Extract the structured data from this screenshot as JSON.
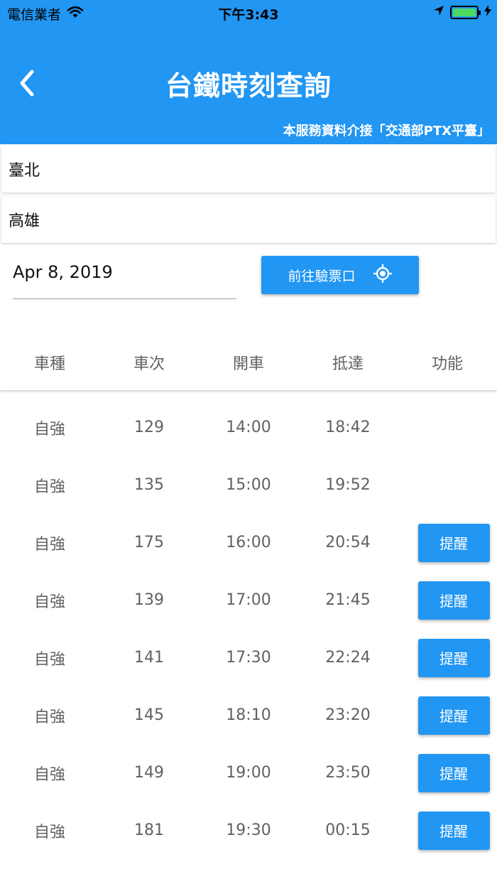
{
  "status_bar": {
    "carrier": "電信業者",
    "time": "下午3:43"
  },
  "header": {
    "title": "台鐵時刻查詢",
    "data_source": "本服務資料介接「交通部PTX平臺」"
  },
  "stations": {
    "origin": "臺北",
    "destination": "高雄"
  },
  "date": {
    "value": "Apr 8, 2019"
  },
  "gate_button": {
    "label": "前往驗票口"
  },
  "table": {
    "headers": [
      "車種",
      "車次",
      "開車",
      "抵達",
      "功能"
    ],
    "remind_label": "提醒",
    "rows": [
      {
        "type": "自強",
        "train": "129",
        "depart": "14:00",
        "arrive": "18:42",
        "remind": false
      },
      {
        "type": "自強",
        "train": "135",
        "depart": "15:00",
        "arrive": "19:52",
        "remind": false
      },
      {
        "type": "自強",
        "train": "175",
        "depart": "16:00",
        "arrive": "20:54",
        "remind": true
      },
      {
        "type": "自強",
        "train": "139",
        "depart": "17:00",
        "arrive": "21:45",
        "remind": true
      },
      {
        "type": "自強",
        "train": "141",
        "depart": "17:30",
        "arrive": "22:24",
        "remind": true
      },
      {
        "type": "自強",
        "train": "145",
        "depart": "18:10",
        "arrive": "23:20",
        "remind": true
      },
      {
        "type": "自強",
        "train": "149",
        "depart": "19:00",
        "arrive": "23:50",
        "remind": true
      },
      {
        "type": "自強",
        "train": "181",
        "depart": "19:30",
        "arrive": "00:15",
        "remind": true
      }
    ]
  },
  "colors": {
    "primary": "#2196f3",
    "battery": "#4cd964"
  },
  "icons": {
    "back": "chevron-left-icon",
    "gate": "gps-target-icon",
    "wifi": "wifi-icon",
    "location": "location-arrow-icon",
    "battery": "battery-icon",
    "charging": "charging-bolt-icon"
  }
}
